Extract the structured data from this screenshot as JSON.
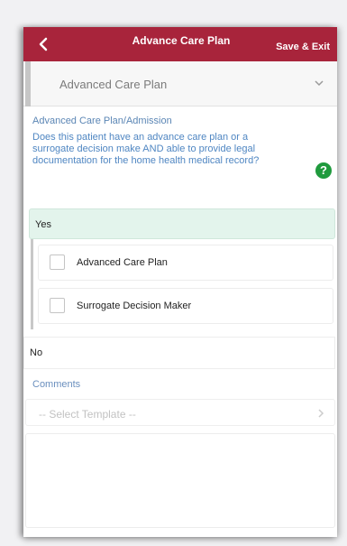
{
  "app_bar": {
    "title": "Advance Care Plan",
    "action_label": "Save & Exit",
    "back_icon": "chevron-left-icon",
    "color": "#a8243b"
  },
  "section": {
    "selected": "Advanced Care Plan",
    "icon": "chevron-down-icon"
  },
  "question": {
    "heading": "Advanced Care Plan/Admission",
    "text": "Does this patient have an advance care plan or a surrogate decision make AND able to provide legal documentation for the home health medical record?",
    "help_icon": "help-icon",
    "help_glyph": "?",
    "help_color": "#1f9a3d"
  },
  "options": {
    "yes": "Yes",
    "no": "No",
    "selected_bg": "#e3f4ec",
    "sub_options": [
      {
        "label": "Advanced Care Plan",
        "checked": false
      },
      {
        "label": "Surrogate Decision Maker",
        "checked": false
      }
    ]
  },
  "comments": {
    "label": "Comments",
    "template_placeholder": "-- Select Template --",
    "text": ""
  }
}
